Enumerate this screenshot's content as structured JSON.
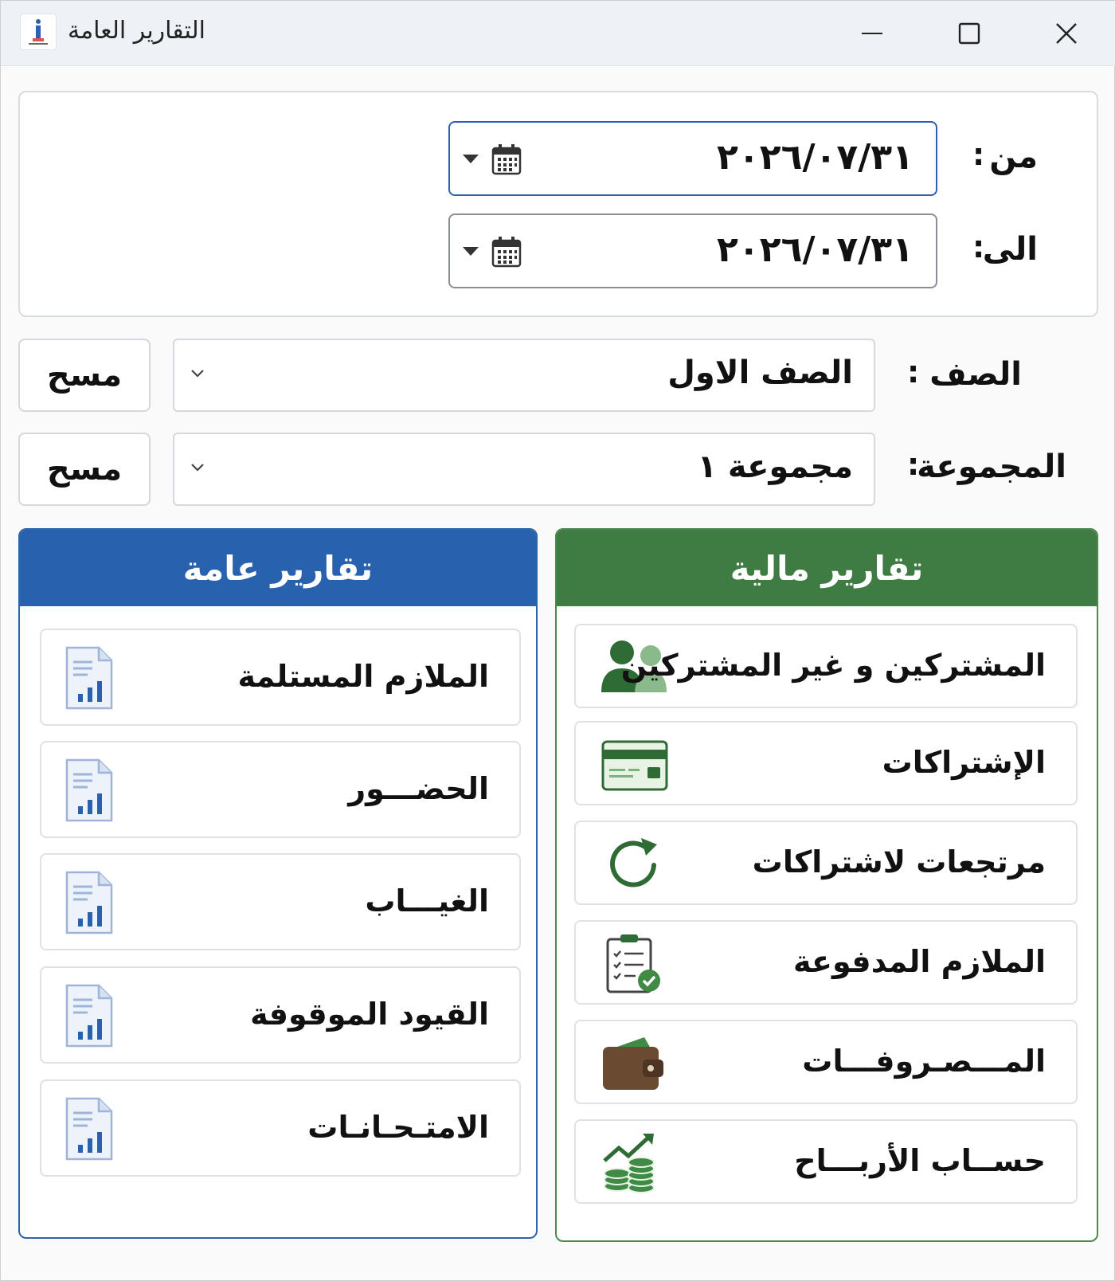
{
  "window": {
    "title": "التقارير العامة",
    "controls": [
      "minimize-icon",
      "maximize-icon",
      "close-icon"
    ]
  },
  "date_range": {
    "from_label": "من",
    "to_label": "الى",
    "colon": ":",
    "from_value": "٢٠٢٦/٠٧/٣١",
    "to_value": "٢٠٢٦/٠٧/٣١"
  },
  "filters": {
    "colon": ":",
    "class_label": "الصف",
    "class_value": "الصف الاول",
    "group_label": "المجموعة",
    "group_value": "مجموعة ١",
    "clear_label": "مسح"
  },
  "financial_reports": {
    "header": "تقارير مالية",
    "accent_color": "#3f7c44",
    "items": [
      {
        "label": "المشتركين و غير المشتركين",
        "icon": "users-icon"
      },
      {
        "label": "الإشتراكات",
        "icon": "credit-card-icon"
      },
      {
        "label": "مرتجعات لاشتراكات",
        "icon": "refresh-icon"
      },
      {
        "label": "الملازم المدفوعة",
        "icon": "clipboard-check-icon"
      },
      {
        "label": "المـــصـروفـــات",
        "icon": "wallet-icon"
      },
      {
        "label": "حســاب الأربـــاح",
        "icon": "coins-growth-icon"
      }
    ]
  },
  "general_reports": {
    "header": "تقارير عامة",
    "accent_color": "#2861ae",
    "items": [
      {
        "label": "الملازم المستلمة",
        "icon": "report-chart-icon"
      },
      {
        "label": "الحضـــور",
        "icon": "report-chart-icon"
      },
      {
        "label": "الغيـــاب",
        "icon": "report-chart-icon"
      },
      {
        "label": "القيود الموقوفة",
        "icon": "report-chart-icon"
      },
      {
        "label": "الامتـحـانـات",
        "icon": "report-chart-icon"
      }
    ]
  }
}
